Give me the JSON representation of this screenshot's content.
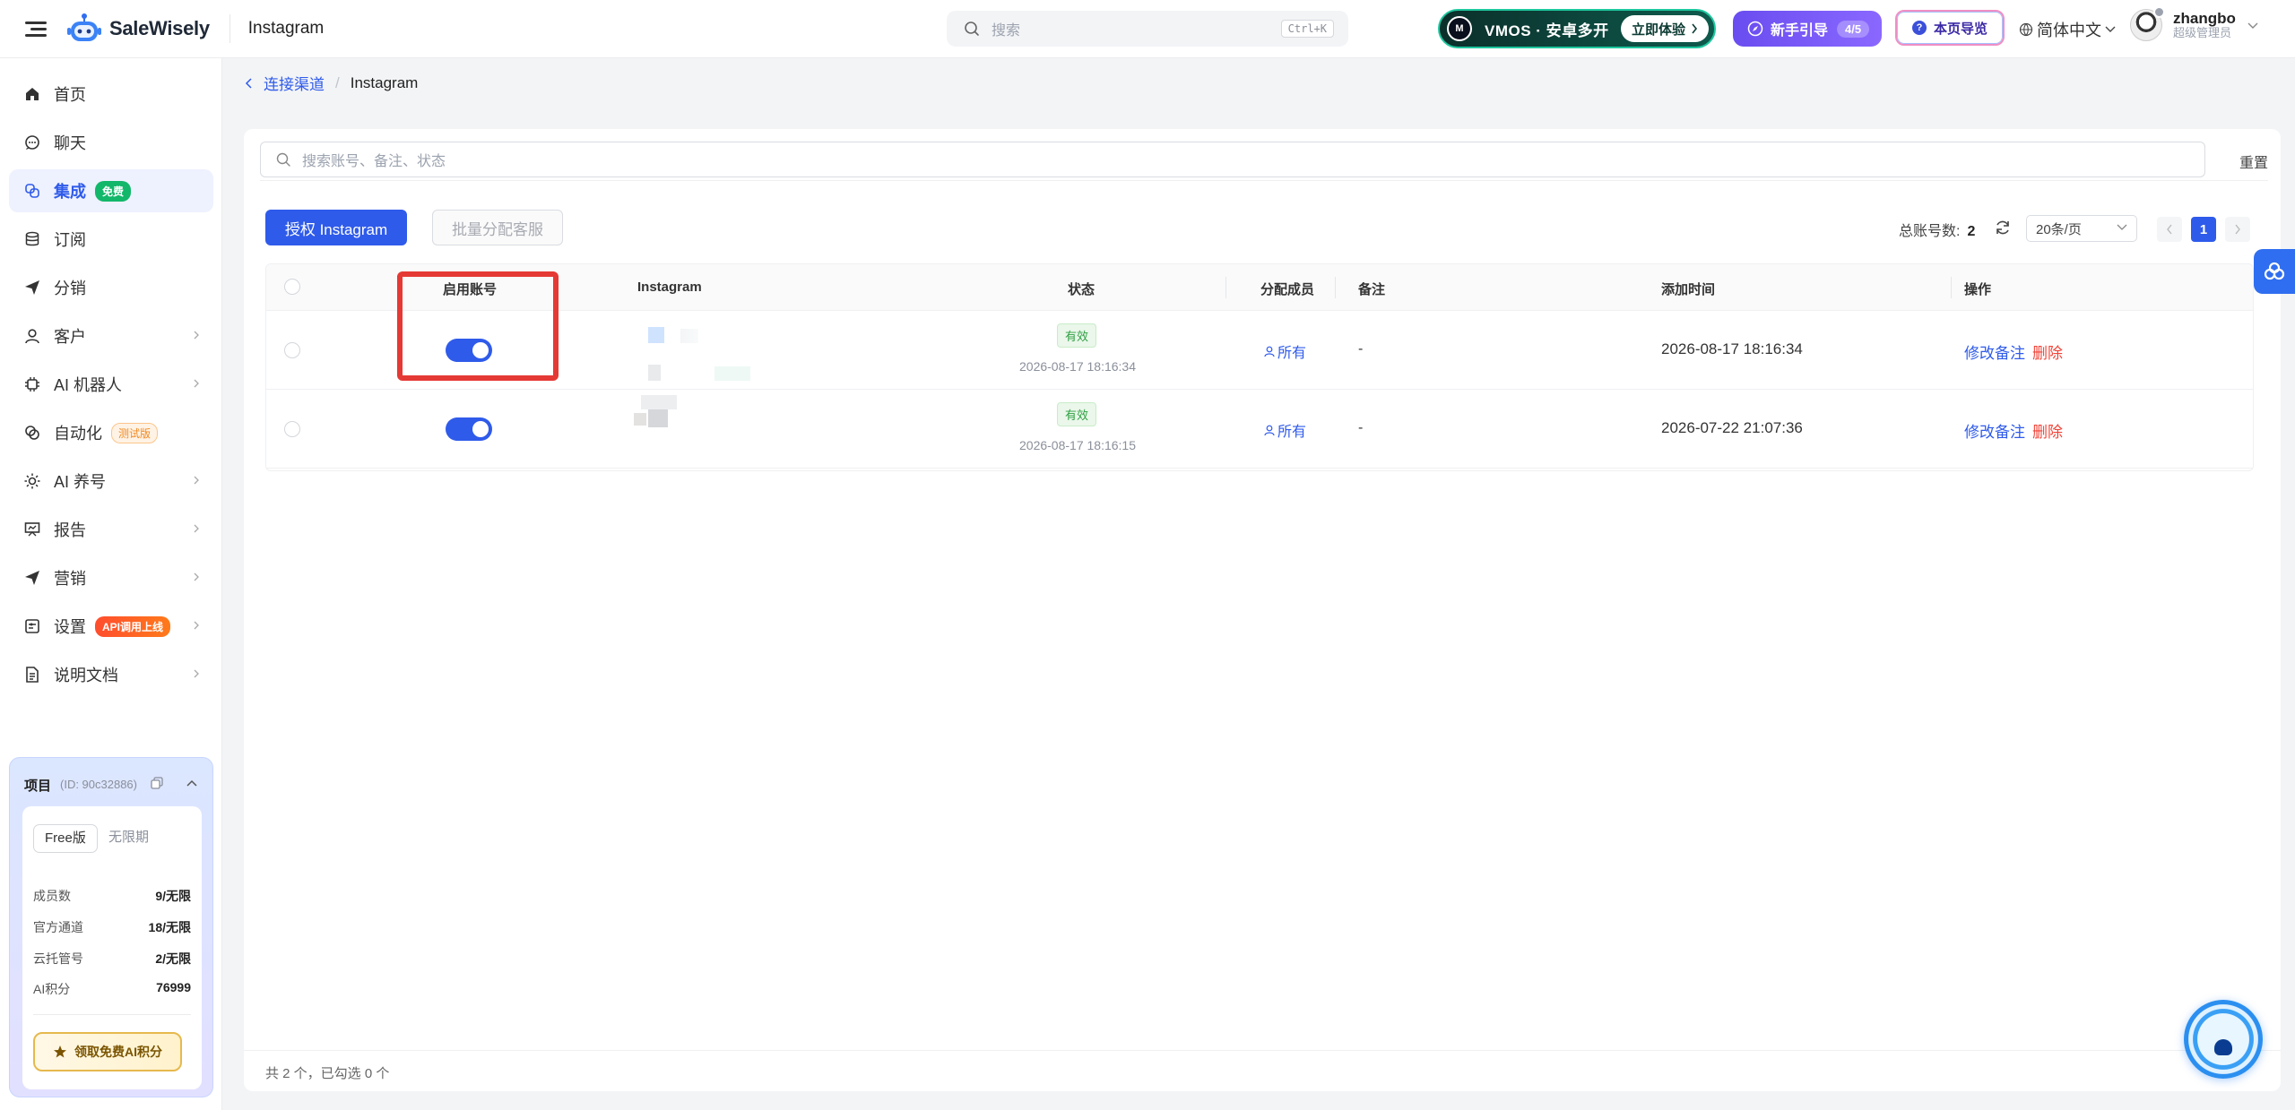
{
  "header": {
    "brand": "SaleWisely",
    "page_name": "Instagram",
    "search_placeholder": "搜索",
    "search_shortcut": "Ctrl+K",
    "vmos_text": "VMOS · 安卓多开",
    "vmos_logo": "M",
    "vmos_button": "立即体验",
    "guide_label": "新手引导",
    "guide_count": "4/5",
    "page_tour": "本页导览",
    "language": "简体中文",
    "user_name": "zhangbo",
    "user_role": "超级管理员"
  },
  "sidebar": {
    "items": [
      {
        "label": "首页",
        "icon": "home-icon"
      },
      {
        "label": "聊天",
        "icon": "chat-icon"
      },
      {
        "label": "集成",
        "icon": "integration-icon",
        "badge": "免费",
        "active": true
      },
      {
        "label": "订阅",
        "icon": "database-icon"
      },
      {
        "label": "分销",
        "icon": "send-icon"
      },
      {
        "label": "客户",
        "icon": "user-icon",
        "has_children": true
      },
      {
        "label": "AI 机器人",
        "icon": "chip-icon",
        "has_children": true
      },
      {
        "label": "自动化",
        "icon": "automation-icon",
        "badge": "测试版"
      },
      {
        "label": "AI 养号",
        "icon": "sun-icon",
        "has_children": true
      },
      {
        "label": "报告",
        "icon": "report-icon",
        "has_children": true
      },
      {
        "label": "营销",
        "icon": "send-icon",
        "has_children": true
      },
      {
        "label": "设置",
        "icon": "settings-icon",
        "badge": "API调用上线",
        "has_children": true
      },
      {
        "label": "说明文档",
        "icon": "doc-icon",
        "has_children": true
      }
    ]
  },
  "project": {
    "title": "项目",
    "id_text": "(ID: 90c32886)",
    "plan": "Free版",
    "term": "无限期",
    "stats": [
      {
        "label": "成员数",
        "value": "9/无限"
      },
      {
        "label": "官方通道",
        "value": "18/无限"
      },
      {
        "label": "云托管号",
        "value": "2/无限"
      },
      {
        "label": "AI积分",
        "value": "76999"
      }
    ],
    "claim_button": "领取免费AI积分"
  },
  "breadcrumb": {
    "parent": "连接渠道",
    "separator": "/",
    "current": "Instagram"
  },
  "toolbar": {
    "filter_placeholder": "搜索账号、备注、状态",
    "reset": "重置",
    "authorize": "授权 Instagram",
    "bulk_assign": "批量分配客服",
    "total_label": "总账号数:",
    "total_value": "2",
    "page_size": "20条/页",
    "current_page": "1"
  },
  "table": {
    "columns": [
      "启用账号",
      "Instagram",
      "状态",
      "分配成员",
      "备注",
      "添加时间",
      "操作"
    ],
    "rows": [
      {
        "enabled": true,
        "status": "有效",
        "status_time": "2026-08-17 18:16:34",
        "member": "所有",
        "remark": "-",
        "added": "2026-08-17 18:16:34",
        "edit": "修改备注",
        "delete": "删除"
      },
      {
        "enabled": true,
        "status": "有效",
        "status_time": "2026-08-17 18:16:15",
        "member": "所有",
        "remark": "-",
        "added": "2026-07-22 21:07:36",
        "edit": "修改备注",
        "delete": "删除"
      }
    ]
  },
  "footer": {
    "summary": "共 2 个，已勾选 0 个"
  },
  "colors": {
    "primary": "#2f5bea",
    "danger": "#f04438",
    "success": "#2ea043",
    "highlight": "#e53935"
  }
}
